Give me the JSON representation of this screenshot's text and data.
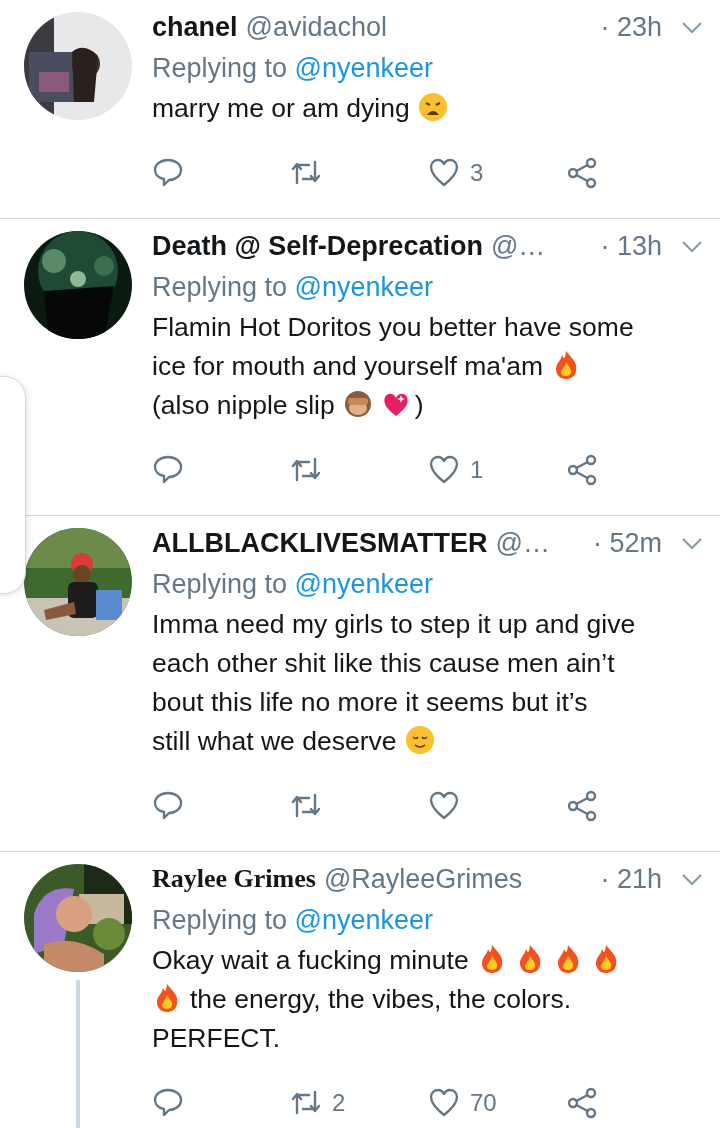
{
  "tweets": [
    {
      "name": "chanel",
      "handle": "@avidachol",
      "time": "· 23h",
      "replying_label": "Replying to",
      "replying_to": "@nyenkeer",
      "lines": [
        [
          {
            "kind": "text",
            "text": "marry me or am dying"
          },
          {
            "kind": "weary"
          }
        ]
      ],
      "like_count": "3",
      "thread": false
    },
    {
      "name": "Death @ Self-Deprecation",
      "handle": "@…",
      "time": "· 13h",
      "replying_label": "Replying to",
      "replying_to": "@nyenkeer",
      "lines": [
        [
          {
            "kind": "text",
            "text": "Flamin Hot Doritos you better have some"
          }
        ],
        [
          {
            "kind": "text",
            "text": "ice for mouth and yourself ma'am"
          },
          {
            "kind": "fire"
          }
        ],
        [
          {
            "kind": "text",
            "text": "(also nipple slip"
          },
          {
            "kind": "monkey"
          },
          {
            "kind": "heart"
          },
          {
            "kind": "text",
            "text": ")"
          }
        ]
      ],
      "like_count": "1",
      "thread": false
    },
    {
      "name": "ALLBLACKLIVESMATTER",
      "handle": "@…",
      "time": "· 52m",
      "replying_label": "Replying to",
      "replying_to": "@nyenkeer",
      "lines": [
        [
          {
            "kind": "text",
            "text": "Imma need my girls to step it up and give"
          }
        ],
        [
          {
            "kind": "text",
            "text": "each other shit like this cause men ain’t"
          }
        ],
        [
          {
            "kind": "text",
            "text": "bout this life no more it seems but it’s"
          }
        ],
        [
          {
            "kind": "text",
            "text": "still what we deserve"
          },
          {
            "kind": "relieved"
          }
        ]
      ],
      "thread": false
    },
    {
      "name": "Raylee Grimes",
      "handle": "@RayleeGrimes",
      "time": "· 21h",
      "replying_label": "Replying to",
      "replying_to": "@nyenkeer",
      "lines": [
        [
          {
            "kind": "text",
            "text": "Okay wait a fucking minute"
          },
          {
            "kind": "fire"
          },
          {
            "kind": "fire"
          },
          {
            "kind": "fire"
          },
          {
            "kind": "fire"
          }
        ],
        [
          {
            "kind": "fire"
          },
          {
            "kind": "text",
            "text": "the energy, the vibes, the colors."
          }
        ],
        [
          {
            "kind": "text",
            "text": "PERFECT."
          }
        ]
      ],
      "retweet_count": "2",
      "like_count": "70",
      "thread": true,
      "name_blackletter": true
    }
  ]
}
